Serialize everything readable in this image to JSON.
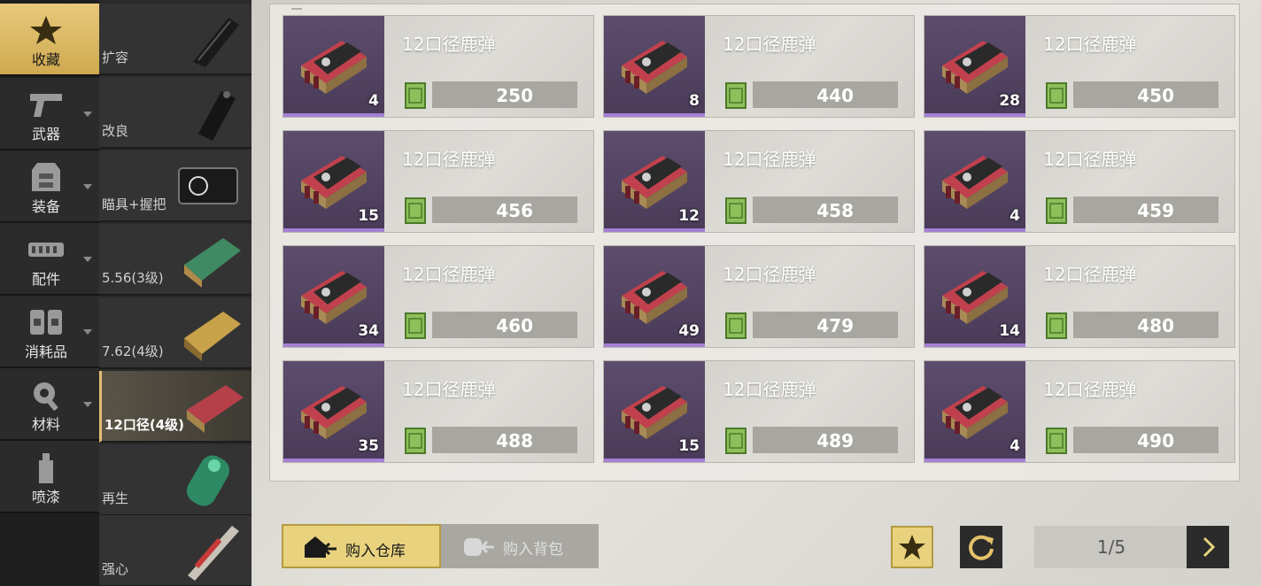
{
  "categories": [
    {
      "label": "收藏",
      "icon": "star-icon",
      "active": true
    },
    {
      "label": "武器",
      "icon": "pistol-icon"
    },
    {
      "label": "装备",
      "icon": "vest-icon"
    },
    {
      "label": "配件",
      "icon": "attachment-icon"
    },
    {
      "label": "消耗品",
      "icon": "consumable-icon"
    },
    {
      "label": "材料",
      "icon": "gear-wrench-icon"
    },
    {
      "label": "喷漆",
      "icon": "spray-can-icon"
    }
  ],
  "subcategories": [
    {
      "label": "扩容",
      "icon": "magazine-icon"
    },
    {
      "label": "改良",
      "icon": "grip-icon"
    },
    {
      "label": "瞄具+握把",
      "icon": "scope-icon"
    },
    {
      "label": "5.56(3级)",
      "icon": "ammo-box-green-icon"
    },
    {
      "label": "7.62(4级)",
      "icon": "ammo-box-yellow-icon"
    },
    {
      "label": "12口径(4级)",
      "icon": "shell-box-icon",
      "active": true
    },
    {
      "label": "再生",
      "icon": "regen-canister-icon"
    },
    {
      "label": "强心",
      "icon": "adrenaline-syringe-icon"
    }
  ],
  "items": [
    {
      "name": "12口径鹿弹",
      "qty": "4",
      "price": "250"
    },
    {
      "name": "12口径鹿弹",
      "qty": "8",
      "price": "440"
    },
    {
      "name": "12口径鹿弹",
      "qty": "28",
      "price": "450"
    },
    {
      "name": "12口径鹿弹",
      "qty": "15",
      "price": "456"
    },
    {
      "name": "12口径鹿弹",
      "qty": "12",
      "price": "458"
    },
    {
      "name": "12口径鹿弹",
      "qty": "4",
      "price": "459"
    },
    {
      "name": "12口径鹿弹",
      "qty": "34",
      "price": "460"
    },
    {
      "name": "12口径鹿弹",
      "qty": "49",
      "price": "479"
    },
    {
      "name": "12口径鹿弹",
      "qty": "14",
      "price": "480"
    },
    {
      "name": "12口径鹿弹",
      "qty": "35",
      "price": "488"
    },
    {
      "name": "12口径鹿弹",
      "qty": "15",
      "price": "489"
    },
    {
      "name": "12口径鹿弹",
      "qty": "4",
      "price": "490"
    }
  ],
  "buy": {
    "warehouse_label": "购入仓库",
    "backpack_label": "购入背包"
  },
  "pager": {
    "text": "1/5"
  },
  "colors": {
    "accent_gold": "#e8d27e",
    "rarity_purple": "#a57fd6",
    "dark_panel": "#2b2b2b"
  }
}
